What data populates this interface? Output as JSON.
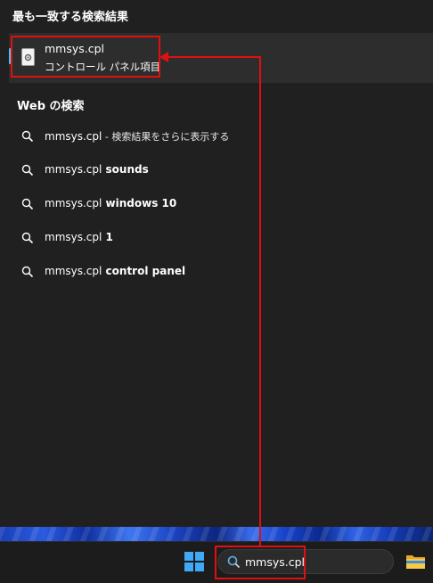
{
  "best_match": {
    "section_title": "最も一致する検索結果",
    "name": "mmsys.cpl",
    "subtitle": "コントロール パネル項目"
  },
  "web": {
    "section_title": "Web の検索",
    "items": [
      {
        "query": "mmsys.cpl",
        "rest": "",
        "suffix": " - 検索結果をさらに表示する"
      },
      {
        "query": "mmsys.cpl",
        "rest": " sounds",
        "suffix": ""
      },
      {
        "query": "mmsys.cpl",
        "rest": " windows 10",
        "suffix": ""
      },
      {
        "query": "mmsys.cpl",
        "rest": " 1",
        "suffix": ""
      },
      {
        "query": "mmsys.cpl",
        "rest": " control panel",
        "suffix": ""
      }
    ]
  },
  "taskbar": {
    "search_value": "mmsys.cpl",
    "icons": [
      "windows-start-icon",
      "search-icon",
      "file-explorer-icon"
    ]
  },
  "colors": {
    "annotation": "#e01010",
    "accent": "#4cc2ff",
    "panel_bg": "#202020",
    "selected_bg": "#2d2d2d"
  }
}
